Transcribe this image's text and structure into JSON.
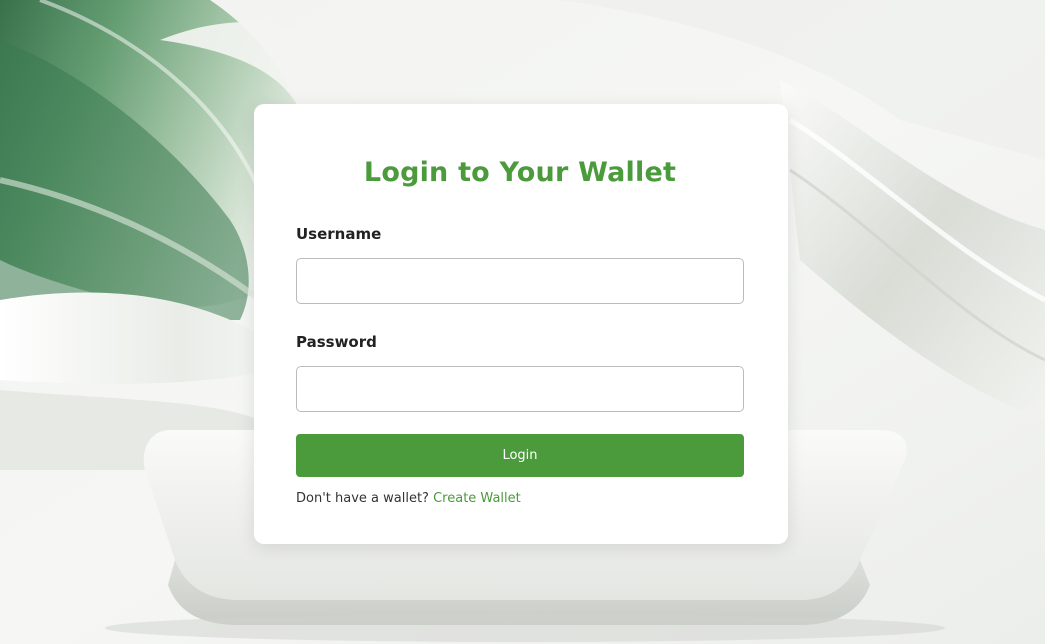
{
  "login_card": {
    "title": "Login to Your Wallet",
    "username_label": "Username",
    "username_value": "",
    "password_label": "Password",
    "password_value": "",
    "login_button_label": "Login",
    "signup_prompt": "Don't have a wallet?",
    "signup_link_label": "Create Wallet"
  },
  "colors": {
    "accent": "#4b9a3c",
    "card_background": "#ffffff",
    "input_border": "#b9bdb8",
    "background_light": "#eef0ed",
    "background_green": "#3f7a52"
  }
}
